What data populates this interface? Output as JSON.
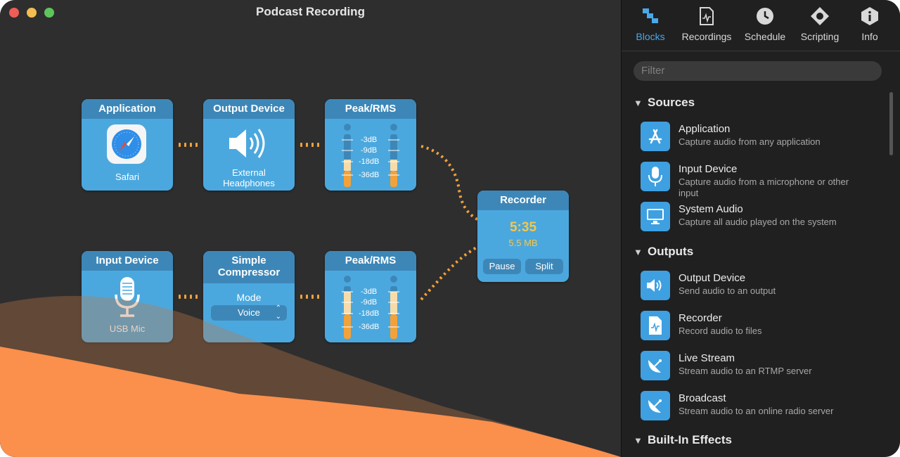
{
  "window": {
    "title": "Podcast Recording"
  },
  "toolbar": {
    "items": [
      {
        "label": "Blocks",
        "icon": "blocks-icon"
      },
      {
        "label": "Recordings",
        "icon": "recordings-icon"
      },
      {
        "label": "Schedule",
        "icon": "clock-icon"
      },
      {
        "label": "Scripting",
        "icon": "scripting-icon"
      },
      {
        "label": "Info",
        "icon": "info-icon"
      }
    ]
  },
  "filter": {
    "placeholder": "Filter"
  },
  "library": {
    "sources": {
      "title": "Sources",
      "items": [
        {
          "name": "Application",
          "desc": "Capture audio from any application"
        },
        {
          "name": "Input Device",
          "desc": "Capture audio from a microphone or other input"
        },
        {
          "name": "System Audio",
          "desc": "Capture all audio played on the system"
        }
      ]
    },
    "outputs": {
      "title": "Outputs",
      "items": [
        {
          "name": "Output Device",
          "desc": "Send audio to an output"
        },
        {
          "name": "Recorder",
          "desc": "Record audio to files"
        },
        {
          "name": "Live Stream",
          "desc": "Stream audio to an RTMP server"
        },
        {
          "name": "Broadcast",
          "desc": "Stream audio to an online radio server"
        }
      ]
    },
    "effects": {
      "title": "Built-In Effects"
    }
  },
  "blocks": {
    "application": {
      "title": "Application",
      "sub": "Safari"
    },
    "output_device": {
      "title": "Output Device",
      "sub1": "External",
      "sub2": "Headphones"
    },
    "peak1": {
      "title": "Peak/RMS",
      "labels": [
        "-3dB",
        "-9dB",
        "-18dB",
        "-36dB"
      ]
    },
    "input_device": {
      "title": "Input Device",
      "sub": "USB Mic"
    },
    "compressor": {
      "title1": "Simple",
      "title2": "Compressor",
      "mode_label": "Mode",
      "mode_value": "Voice"
    },
    "peak2": {
      "title": "Peak/RMS",
      "labels": [
        "-3dB",
        "-9dB",
        "-18dB",
        "-36dB"
      ]
    },
    "recorder": {
      "title": "Recorder",
      "time": "5:35",
      "size": "5.5 MB",
      "pause": "Pause",
      "split": "Split"
    }
  },
  "colors": {
    "accent": "#4aa8e8",
    "block": "#4ba8de",
    "connector": "#f2a23a",
    "wave": "#fb8f4c"
  }
}
